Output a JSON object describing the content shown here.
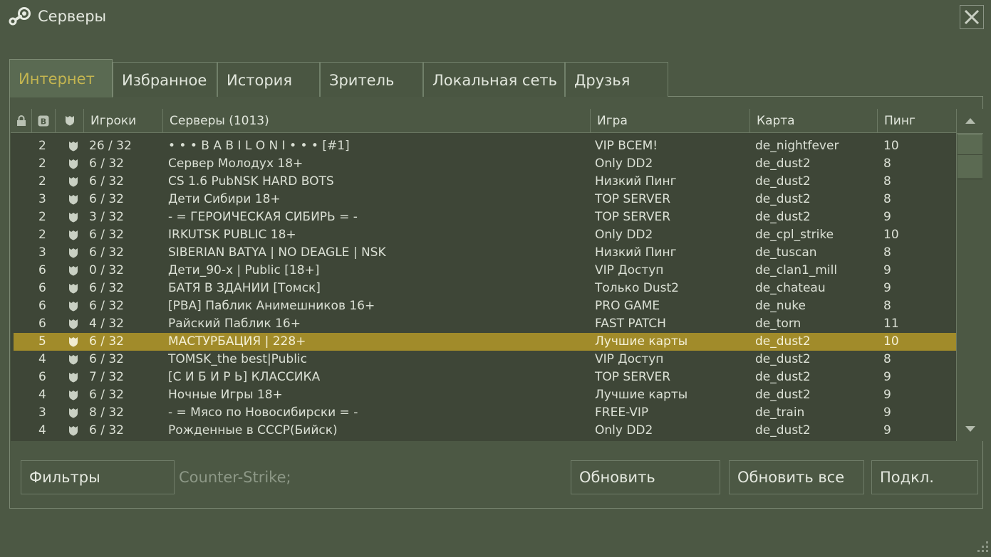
{
  "window": {
    "title": "Серверы",
    "icons": {
      "app": "steam-icon",
      "close": "close-icon"
    }
  },
  "tabs": [
    {
      "label": "Интернет",
      "active": true
    },
    {
      "label": "Избранное",
      "active": false
    },
    {
      "label": "История",
      "active": false
    },
    {
      "label": "Зритель",
      "active": false
    },
    {
      "label": "Локальная сеть",
      "active": false
    },
    {
      "label": "Друзья",
      "active": false
    }
  ],
  "table": {
    "columns": {
      "lock_icon": "lock-icon",
      "bots_icon": "bots-icon",
      "secure_icon": "shield-icon",
      "players": "Игроки",
      "servers": "Серверы (1013)",
      "game": "Игра",
      "map": "Карта",
      "ping": "Пинг"
    },
    "rows": [
      {
        "bots": "2",
        "players": "26 / 32",
        "name": "• • • B A B I L O N I • • • [#1]",
        "game": "VIP ВСЕМ!",
        "map": "de_nightfever",
        "ping": "10"
      },
      {
        "bots": "2",
        "players": "6 / 32",
        "name": "Сервер Молодух 18+",
        "game": "Only DD2",
        "map": "de_dust2",
        "ping": "8"
      },
      {
        "bots": "2",
        "players": "6 / 32",
        "name": "CS 1.6 PubNSK HARD BOTS",
        "game": "Низкий Пинг",
        "map": "de_dust2",
        "ping": "8"
      },
      {
        "bots": "3",
        "players": "6 / 32",
        "name": "Дети Сибири 18+",
        "game": "TOP SERVER",
        "map": "de_dust2",
        "ping": "8"
      },
      {
        "bots": "2",
        "players": "3 / 32",
        "name": "- =  ГЕРОИЧЕСКАЯ СИБИРЬ  = -",
        "game": "TOP SERVER",
        "map": "de_dust2",
        "ping": "9"
      },
      {
        "bots": "2",
        "players": "6 / 32",
        "name": "IRKUTSK PUBLIC 18+",
        "game": "Only DD2",
        "map": "de_cpl_strike",
        "ping": "10"
      },
      {
        "bots": "3",
        "players": "6 / 32",
        "name": "SIBERIAN BATYA | NO DEAGLE | NSK",
        "game": "Низкий Пинг",
        "map": "de_tuscan",
        "ping": "8"
      },
      {
        "bots": "6",
        "players": "0 / 32",
        "name": "Дети_90-х | Public [18+]",
        "game": "VIP Доступ",
        "map": "de_clan1_mill",
        "ping": "9"
      },
      {
        "bots": "6",
        "players": "6 / 32",
        "name": "БАТЯ В ЗДАНИИ [Томск]",
        "game": "Только Dust2",
        "map": "de_chateau",
        "ping": "9"
      },
      {
        "bots": "6",
        "players": "6 / 32",
        "name": "[PBA]  Паблик Анимешников 16+",
        "game": "PRO GAME",
        "map": "de_nuke",
        "ping": "8"
      },
      {
        "bots": "6",
        "players": "4 / 32",
        "name": "Райский Паблик 16+",
        "game": "FAST PATCH",
        "map": "de_torn",
        "ping": "11"
      },
      {
        "bots": "5",
        "players": "6 / 32",
        "name": "МАСТУРБАЦИЯ | 228+",
        "game": "Лучшие карты",
        "map": "de_dust2",
        "ping": "10",
        "selected": true
      },
      {
        "bots": "4",
        "players": "6 / 32",
        "name": "TOMSK_the best|Public",
        "game": "VIP Доступ",
        "map": "de_dust2",
        "ping": "8"
      },
      {
        "bots": "6",
        "players": "7 / 32",
        "name": "[С И Б И Р Ь] КЛАССИКА",
        "game": "TOP SERVER",
        "map": "de_dust2",
        "ping": "9"
      },
      {
        "bots": "4",
        "players": "6 / 32",
        "name": "Ночные Игры 18+",
        "game": "Лучшие карты",
        "map": "de_dust2",
        "ping": "9"
      },
      {
        "bots": "3",
        "players": "8 / 32",
        "name": "-  =  Мясо по Новосибирски  =  -",
        "game": "FREE-VIP",
        "map": "de_train",
        "ping": "9"
      },
      {
        "bots": "4",
        "players": "6 / 32",
        "name": "Рожденные в СССР(Бийск)",
        "game": "Only DD2",
        "map": "de_dust2",
        "ping": "9"
      }
    ]
  },
  "footer": {
    "filters_label": "Фильтры",
    "filter_summary": "Counter-Strike;",
    "refresh_label": "Обновить",
    "refresh_all_label": "Обновить все",
    "connect_label": "Подкл."
  },
  "colors": {
    "background": "#4c5844",
    "list_background": "#3e4637",
    "selected_row": "#a18b2a",
    "active_tab_text": "#c4b550",
    "text": "#dbe0d5"
  }
}
